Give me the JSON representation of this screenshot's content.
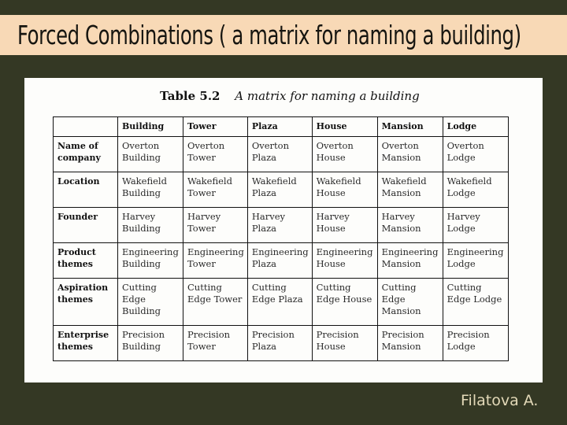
{
  "slide": {
    "title": "Forced Combinations ( a matrix for naming a building)",
    "author": "Filatova A."
  },
  "table": {
    "caption_number": "Table 5.2",
    "caption_text": "A matrix for naming a building",
    "columns": [
      "",
      "Building",
      "Tower",
      "Plaza",
      "House",
      "Mansion",
      "Lodge"
    ],
    "rows": [
      {
        "label": "Name of company",
        "cells": [
          "Overton Building",
          "Overton Tower",
          "Overton Plaza",
          "Overton House",
          "Overton Mansion",
          "Overton Lodge"
        ]
      },
      {
        "label": "Location",
        "cells": [
          "Wakefield Building",
          "Wakefield Tower",
          "Wakefield Plaza",
          "Wakefield House",
          "Wakefield Mansion",
          "Wakefield Lodge"
        ]
      },
      {
        "label": "Founder",
        "cells": [
          "Harvey Building",
          "Harvey Tower",
          "Harvey Plaza",
          "Harvey House",
          "Harvey Mansion",
          "Harvey Lodge"
        ]
      },
      {
        "label": "Product themes",
        "cells": [
          "Engineering Building",
          "Engineering Tower",
          "Engineering Plaza",
          "Engineering House",
          "Engineering Mansion",
          "Engineering Lodge"
        ]
      },
      {
        "label": "Aspiration themes",
        "cells": [
          "Cutting Edge Building",
          "Cutting Edge Tower",
          "Cutting Edge Plaza",
          "Cutting Edge House",
          "Cutting Edge Mansion",
          "Cutting Edge Lodge"
        ]
      },
      {
        "label": "Enterprise themes",
        "cells": [
          "Precision Building",
          "Precision Tower",
          "Precision Plaza",
          "Precision House",
          "Precision Mansion",
          "Precision Lodge"
        ]
      }
    ]
  }
}
